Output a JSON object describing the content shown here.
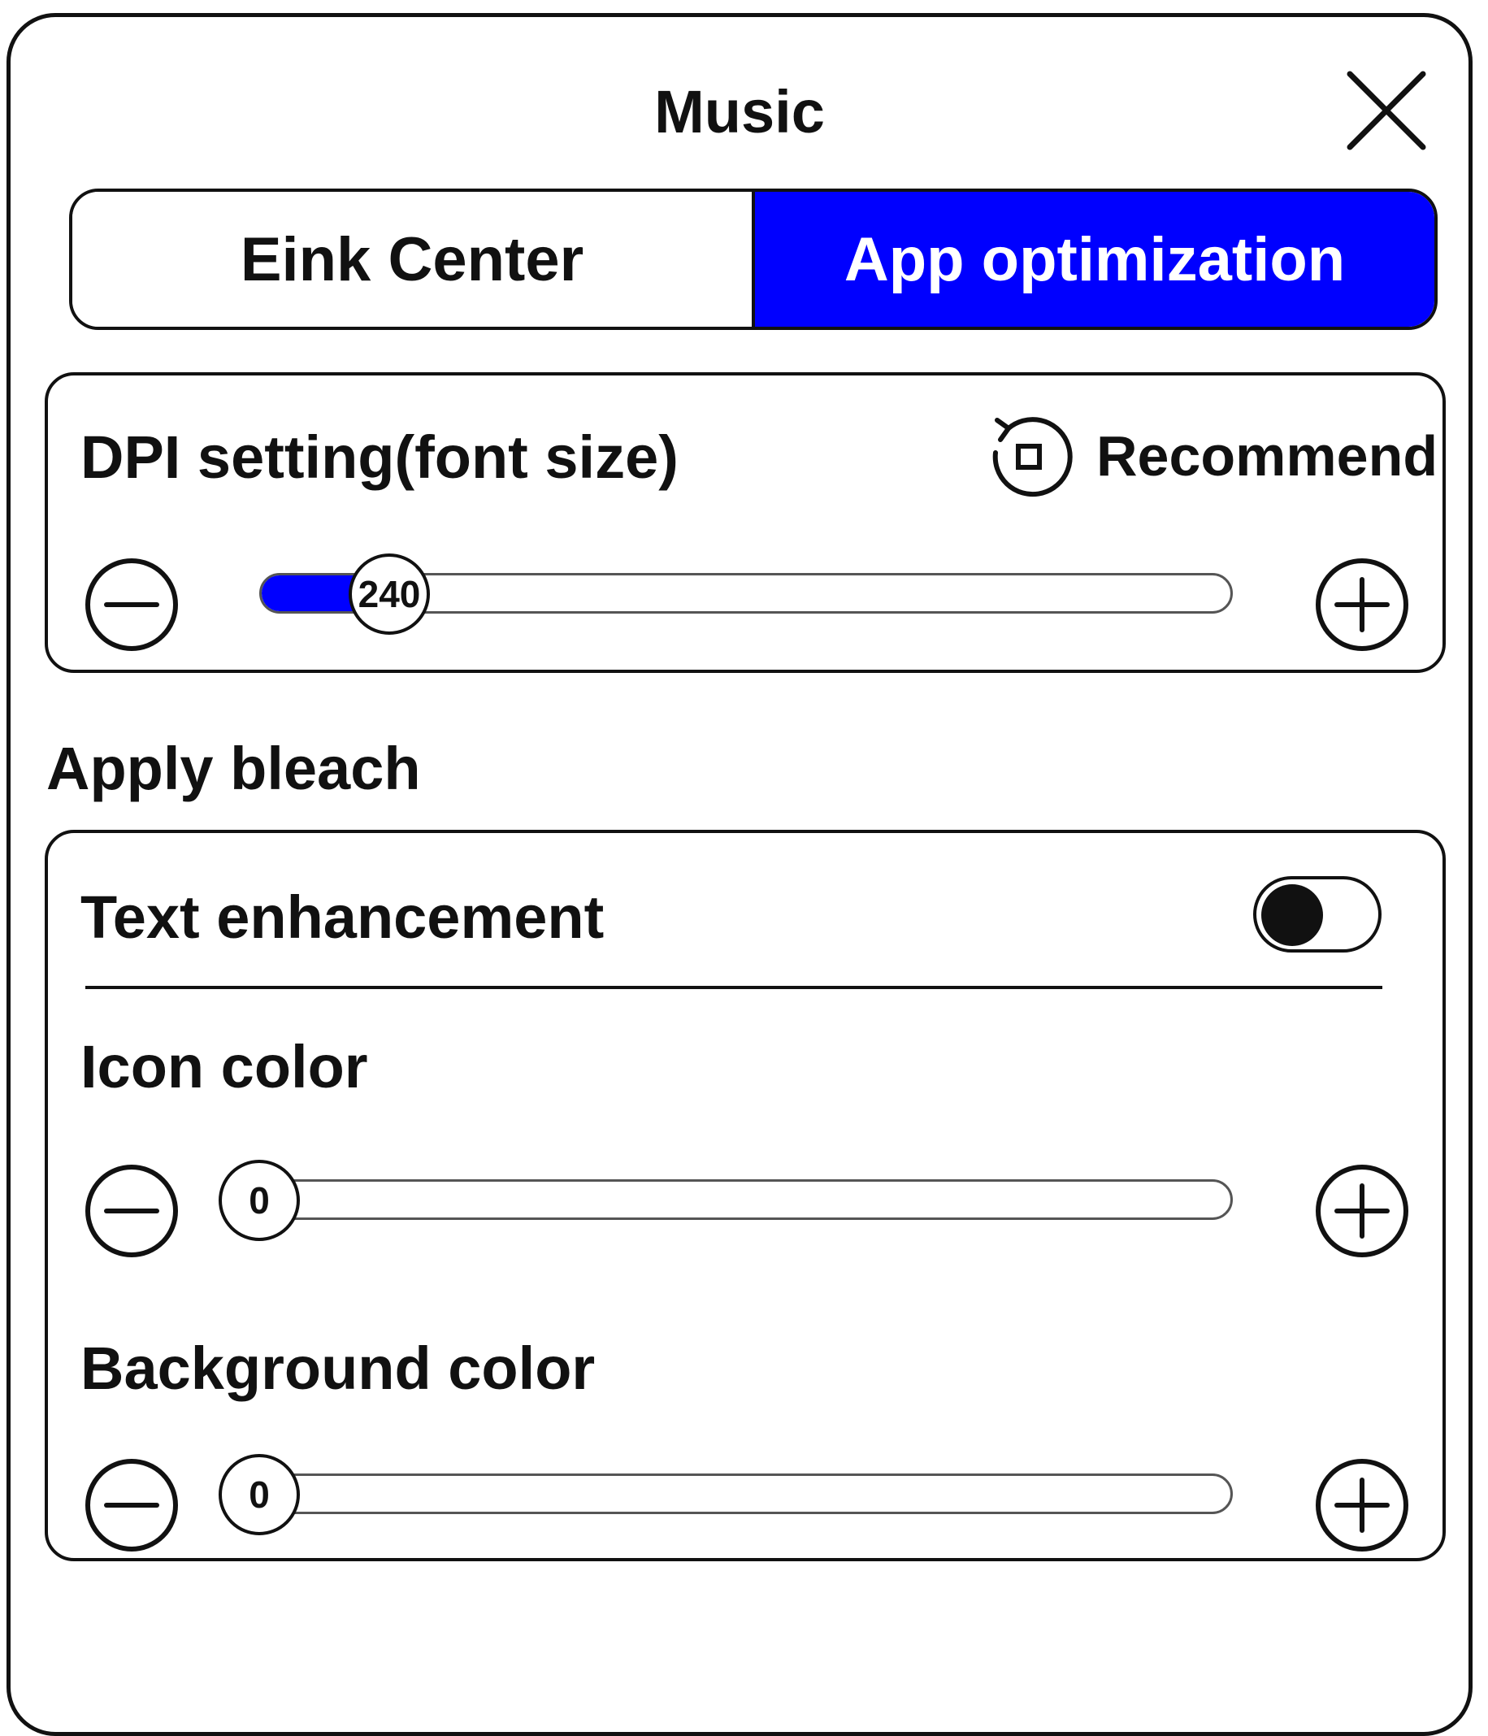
{
  "header": {
    "title": "Music",
    "close_icon": "close-icon"
  },
  "tabs": [
    {
      "label": "Eink Center",
      "active": false
    },
    {
      "label": "App optimization",
      "active": true
    }
  ],
  "accent_color": "#0000ff",
  "dpi": {
    "label": "DPI setting(font size)",
    "recommend_label": "Recommend",
    "recommend_icon": "reset-icon",
    "value": "240",
    "fill_fraction": 0.1,
    "minus_icon": "minus-circle-icon",
    "plus_icon": "plus-circle-icon"
  },
  "bleach": {
    "section_label": "Apply bleach",
    "text_enhancement": {
      "label": "Text enhancement",
      "enabled": false
    },
    "icon_color": {
      "label": "Icon color",
      "value": "0",
      "fill_fraction": 0
    },
    "background_color": {
      "label": "Background color",
      "value": "0",
      "fill_fraction": 0
    }
  }
}
